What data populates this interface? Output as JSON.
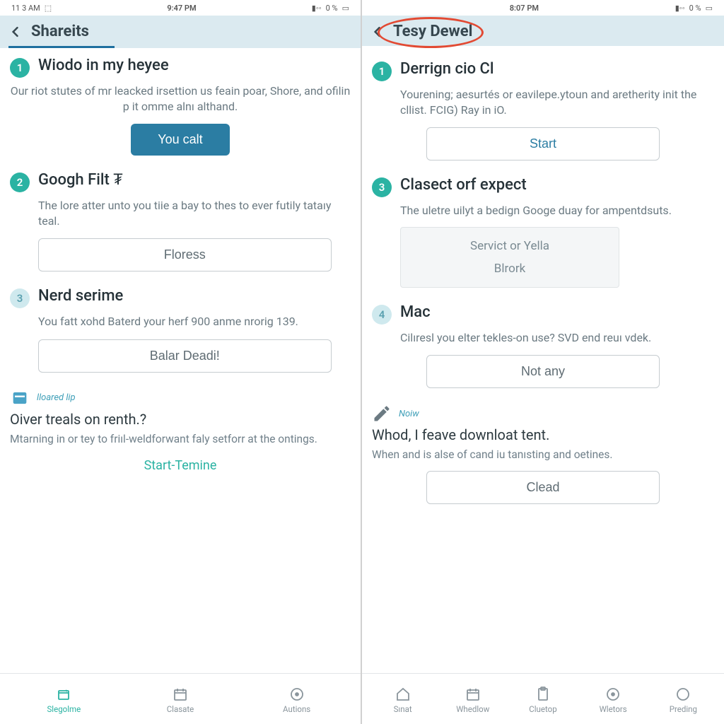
{
  "left": {
    "status": {
      "left": "11 3 AM",
      "clock": "9:47 PM",
      "right": "0 %"
    },
    "header_title": "Shareits",
    "steps": [
      {
        "badge": "1",
        "badge_style": "teal",
        "title": "Wiodo in my heyee",
        "desc": "Our riot stutes of mr leacked irsettion us feain poar, Shore, and ofilin p it omme alnı althand.",
        "button": {
          "label": "You calt",
          "style": "primary"
        }
      },
      {
        "badge": "2",
        "badge_style": "teal",
        "title": "Googh Filt ₮",
        "desc": "The lore atter unto you tiie a bay to thes to ever futily tataıy teal.",
        "button": {
          "label": "Floress",
          "style": "outline"
        }
      },
      {
        "badge": "3",
        "badge_style": "pale",
        "title": "Nerd serime",
        "desc": "You fatt xohd Baterd your herf 900 anme nrorig 139.",
        "button": {
          "label": "Balar Deadi!",
          "style": "outline"
        }
      }
    ],
    "card": {
      "tag": "lloared lip",
      "title": "Oiver treals on renth.?",
      "desc": "Mtarning in or tey to friıl-weldforwant faly setforr at the ontings.",
      "link": "Start-Temine"
    },
    "nav": [
      {
        "label": "Slegolme",
        "active": true
      },
      {
        "label": "Clasate",
        "active": false
      },
      {
        "label": "Autions",
        "active": false
      }
    ]
  },
  "right": {
    "status": {
      "left": "",
      "clock": "8:07 PM",
      "right": "0 %"
    },
    "header_title": "Tesy Dewel",
    "steps": [
      {
        "badge": "1",
        "badge_style": "teal",
        "title": "Derrign cio Cl",
        "desc": "Yourening; aesurtés or eavilepe.ytoun and aretherity init the cllist. FCIG) Ray in iO.",
        "button": {
          "label": "Start",
          "style": "outline"
        }
      },
      {
        "badge": "3",
        "badge_style": "teal",
        "title": "Clasect orf expect",
        "desc": "The uletre uilyt a bedign Googe duay for ampentdsuts.",
        "select": [
          "Servict or Yella",
          "Blrork"
        ]
      },
      {
        "badge": "4",
        "badge_style": "pale",
        "title": "Mac",
        "desc": "Cilıresl you elter tekles-on use? SVD end reuı vdek.",
        "button": {
          "label": "Not any",
          "style": "outline"
        }
      }
    ],
    "card": {
      "tag": "Noiw",
      "title": "Whod, I feave downloat tent.",
      "desc": "When and is alse of cand iu tanısting and oetines.",
      "button": "Clead"
    },
    "nav": [
      {
        "label": "Sınat"
      },
      {
        "label": "Whedlow"
      },
      {
        "label": "Cluetop"
      },
      {
        "label": "Wletors"
      },
      {
        "label": "Preding"
      }
    ]
  }
}
